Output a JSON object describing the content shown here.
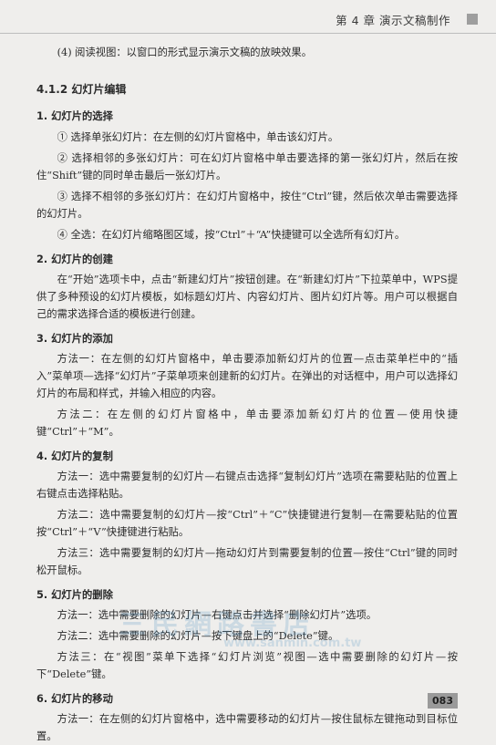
{
  "header": {
    "text": "第 4 章   演示文稿制作"
  },
  "intro": "(4) 阅读视图：以窗口的形式显示演示文稿的放映效果。",
  "section": {
    "title": "4.1.2    幻灯片编辑"
  },
  "s1": {
    "title": "1. 幻灯片的选择",
    "items": [
      "① 选择单张幻灯片：在左侧的幻灯片窗格中，单击该幻灯片。",
      "② 选择相邻的多张幻灯片：可在幻灯片窗格中单击要选择的第一张幻灯片，然后在按住“Shift”键的同时单击最后一张幻灯片。",
      "③ 选择不相邻的多张幻灯片：在幻灯片窗格中，按住“Ctrl”键，然后依次单击需要选择的幻灯片。",
      "④ 全选：在幻灯片缩略图区域，按“Ctrl”＋“A”快捷键可以全选所有幻灯片。"
    ]
  },
  "s2": {
    "title": "2. 幻灯片的创建",
    "text": "在“开始”选项卡中，点击“新建幻灯片”按钮创建。在“新建幻灯片”下拉菜单中，WPS提供了多种预设的幻灯片模板，如标题幻灯片、内容幻灯片、图片幻灯片等。用户可以根据自己的需求选择合适的模板进行创建。"
  },
  "s3": {
    "title": "3. 幻灯片的添加",
    "methods": [
      "方法一：在左侧的幻灯片窗格中，单击要添加新幻灯片的位置—点击菜单栏中的“插入”菜单项—选择“幻灯片”子菜单项来创建新的幻灯片。在弹出的对话框中，用户可以选择幻灯片的布局和样式，并输入相应的内容。",
      "方法二：在左侧的幻灯片窗格中，单击要添加新幻灯片的位置—使用快捷键“Ctrl”＋“M”。"
    ]
  },
  "s4": {
    "title": "4. 幻灯片的复制",
    "methods": [
      "方法一：选中需要复制的幻灯片—右键点击选择“复制幻灯片”选项在需要粘贴的位置上右键点击选择粘贴。",
      "方法二：选中需要复制的幻灯片—按“Ctrl”＋“C”快捷键进行复制—在需要粘贴的位置按“Ctrl”＋“V”快捷键进行粘贴。",
      "方法三：选中需要复制的幻灯片—拖动幻灯片到需要复制的位置—按住“Ctrl”键的同时松开鼠标。"
    ]
  },
  "s5": {
    "title": "5. 幻灯片的删除",
    "methods": [
      "方法一：选中需要删除的幻灯片—右键点击并选择“删除幻灯片”选项。",
      "方法二：选中需要删除的幻灯片—按下键盘上的“Delete”键。",
      "方法三：在“视图”菜单下选择“幻灯片浏览”视图—选中需要删除的幻灯片—按下“Delete”键。"
    ]
  },
  "s6": {
    "title": "6. 幻灯片的移动",
    "methods": [
      "方法一：在左侧的幻灯片窗格中，选中需要移动的幻灯片—按住鼠标左键拖动到目标位置。"
    ]
  },
  "watermark": {
    "text": "三民網路書店",
    "url": "www.sanmin.com.tw"
  },
  "page_number": "083"
}
